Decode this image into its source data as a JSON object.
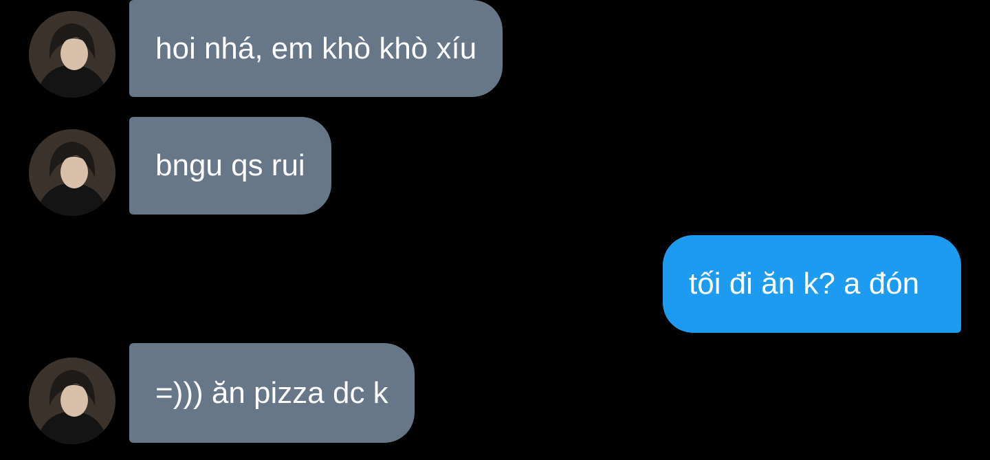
{
  "messages": [
    {
      "sender": "contact",
      "text": "hoi nhá, em khò khò xíu",
      "avatar": "contact-avatar"
    },
    {
      "sender": "contact",
      "text": "bngu qs rui",
      "avatar": "contact-avatar"
    },
    {
      "sender": "me",
      "text": "tối đi ăn k? a đón"
    },
    {
      "sender": "contact",
      "text": "=))) ăn pizza dc k",
      "avatar": "contact-avatar"
    }
  ],
  "colors": {
    "background": "#000000",
    "incoming_bubble": "#677788",
    "outgoing_bubble": "#1d9bf0",
    "text": "#ffffff"
  }
}
